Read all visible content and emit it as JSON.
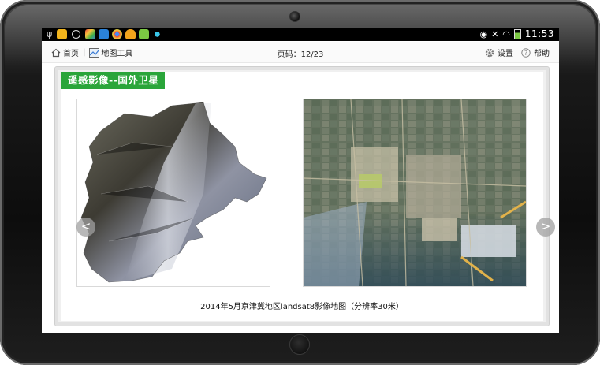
{
  "status_bar": {
    "time": "11:53",
    "battery_level": 0.7
  },
  "nav": {
    "home_label": "首页",
    "separator": "|",
    "map_tools_label": "地图工具",
    "page_indicator": "页码：12/23",
    "settings_label": "设置",
    "help_label": "帮助"
  },
  "slide": {
    "title": "遥感影像--国外卫星",
    "caption": "2014年5月京津冀地区landsat8影像地图（分辨率30米）",
    "prev_arrow": "<",
    "next_arrow": ">"
  },
  "colors": {
    "title_bg": "#2aa53a",
    "status_bar": "#000000",
    "bezel": "#111111"
  }
}
